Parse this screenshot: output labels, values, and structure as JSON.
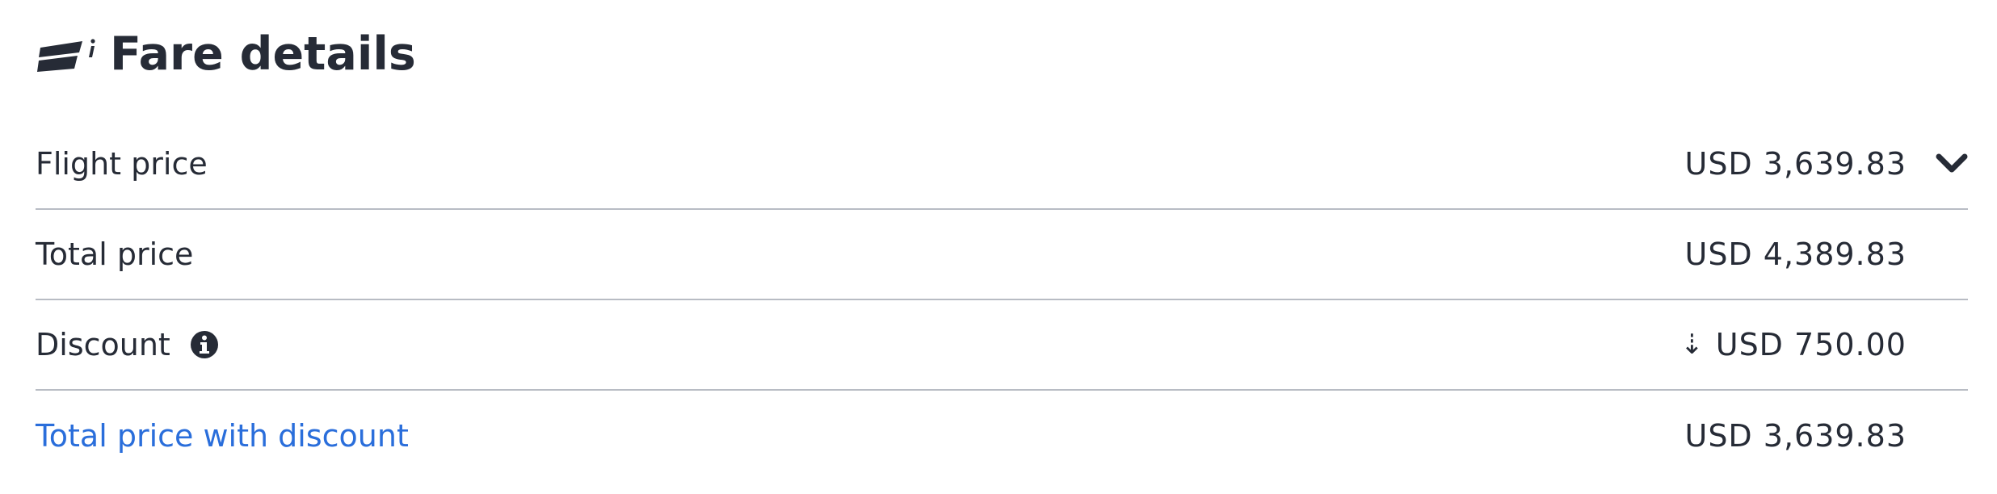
{
  "header": {
    "title": "Fare details",
    "icon": "fare-ticket-info-icon"
  },
  "rows": [
    {
      "label": "Flight price",
      "value": "USD 3,639.83",
      "expand_icon": "chevron-down-icon"
    },
    {
      "label": "Total price",
      "value": "USD 4,389.83"
    },
    {
      "label": "Discount",
      "value": "USD 750.00",
      "prefix_icon": "down-arrow-icon",
      "prefix_glyph": "⇣",
      "info_icon": "info-circle-icon"
    },
    {
      "label": "Total price with discount",
      "value": "USD 3,639.83"
    }
  ],
  "colors": {
    "text": "#262b36",
    "link": "#2a6edb",
    "divider": "#b8bcc4"
  }
}
